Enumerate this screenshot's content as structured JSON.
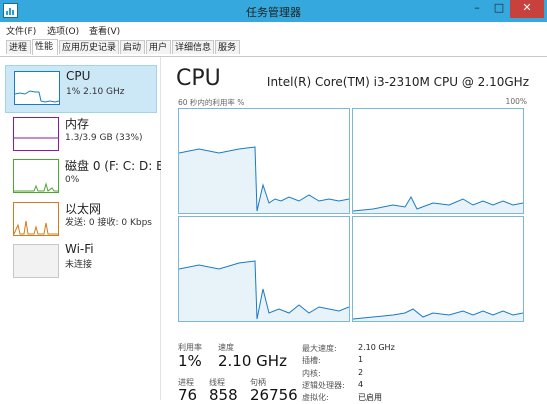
{
  "window": {
    "title": "任务管理器",
    "minimize": "–",
    "maximize": "□",
    "close": "✕"
  },
  "menu": [
    "文件(F)",
    "选项(O)",
    "查看(V)"
  ],
  "tabs": [
    "进程",
    "性能",
    "应用历史记录",
    "启动",
    "用户",
    "详细信息",
    "服务"
  ],
  "active_tab": 1,
  "sidebar": [
    {
      "name": "CPU",
      "detail1": "1% 2.10 GHz",
      "detail2": "",
      "color": "#1a7bc1",
      "selected": true
    },
    {
      "name": "内存",
      "detail1": "1.3/3.9 GB (33%)",
      "detail2": "",
      "color": "#8b1aa5",
      "selected": false
    },
    {
      "name": "磁盘 0 (F: C: D: E:",
      "detail1": "0%",
      "detail2": "",
      "color": "#4fa630",
      "selected": false
    },
    {
      "name": "以太网",
      "detail1": "发送: 0  接收: 0 Kbps",
      "detail2": "",
      "color": "#d27b1b",
      "selected": false
    },
    {
      "name": "Wi-Fi",
      "detail1": "未连接",
      "detail2": "",
      "color": "#b0b0b0",
      "selected": false
    }
  ],
  "main": {
    "title": "CPU",
    "model": "Intel(R) Core(TM) i3-2310M CPU @ 2.10GHz",
    "util_label": "60 秒内的利用率 %",
    "max_label": "100%",
    "graph_line_color": "#1a7bc1",
    "graph_fill_color": "#e8f2f9",
    "stats": {
      "utilization_label": "利用率",
      "utilization": "1%",
      "speed_label": "速度",
      "speed": "2.10 GHz",
      "processes_label": "进程",
      "processes": "76",
      "threads_label": "线程",
      "threads": "858",
      "handles_label": "句柄",
      "handles": "26756"
    },
    "details": [
      {
        "k": "最大速度:",
        "v": "2.10 GHz"
      },
      {
        "k": "插槽:",
        "v": "1"
      },
      {
        "k": "内核:",
        "v": "2"
      },
      {
        "k": "逻辑处理器:",
        "v": "4"
      },
      {
        "k": "虚拟化:",
        "v": "已启用"
      }
    ]
  }
}
